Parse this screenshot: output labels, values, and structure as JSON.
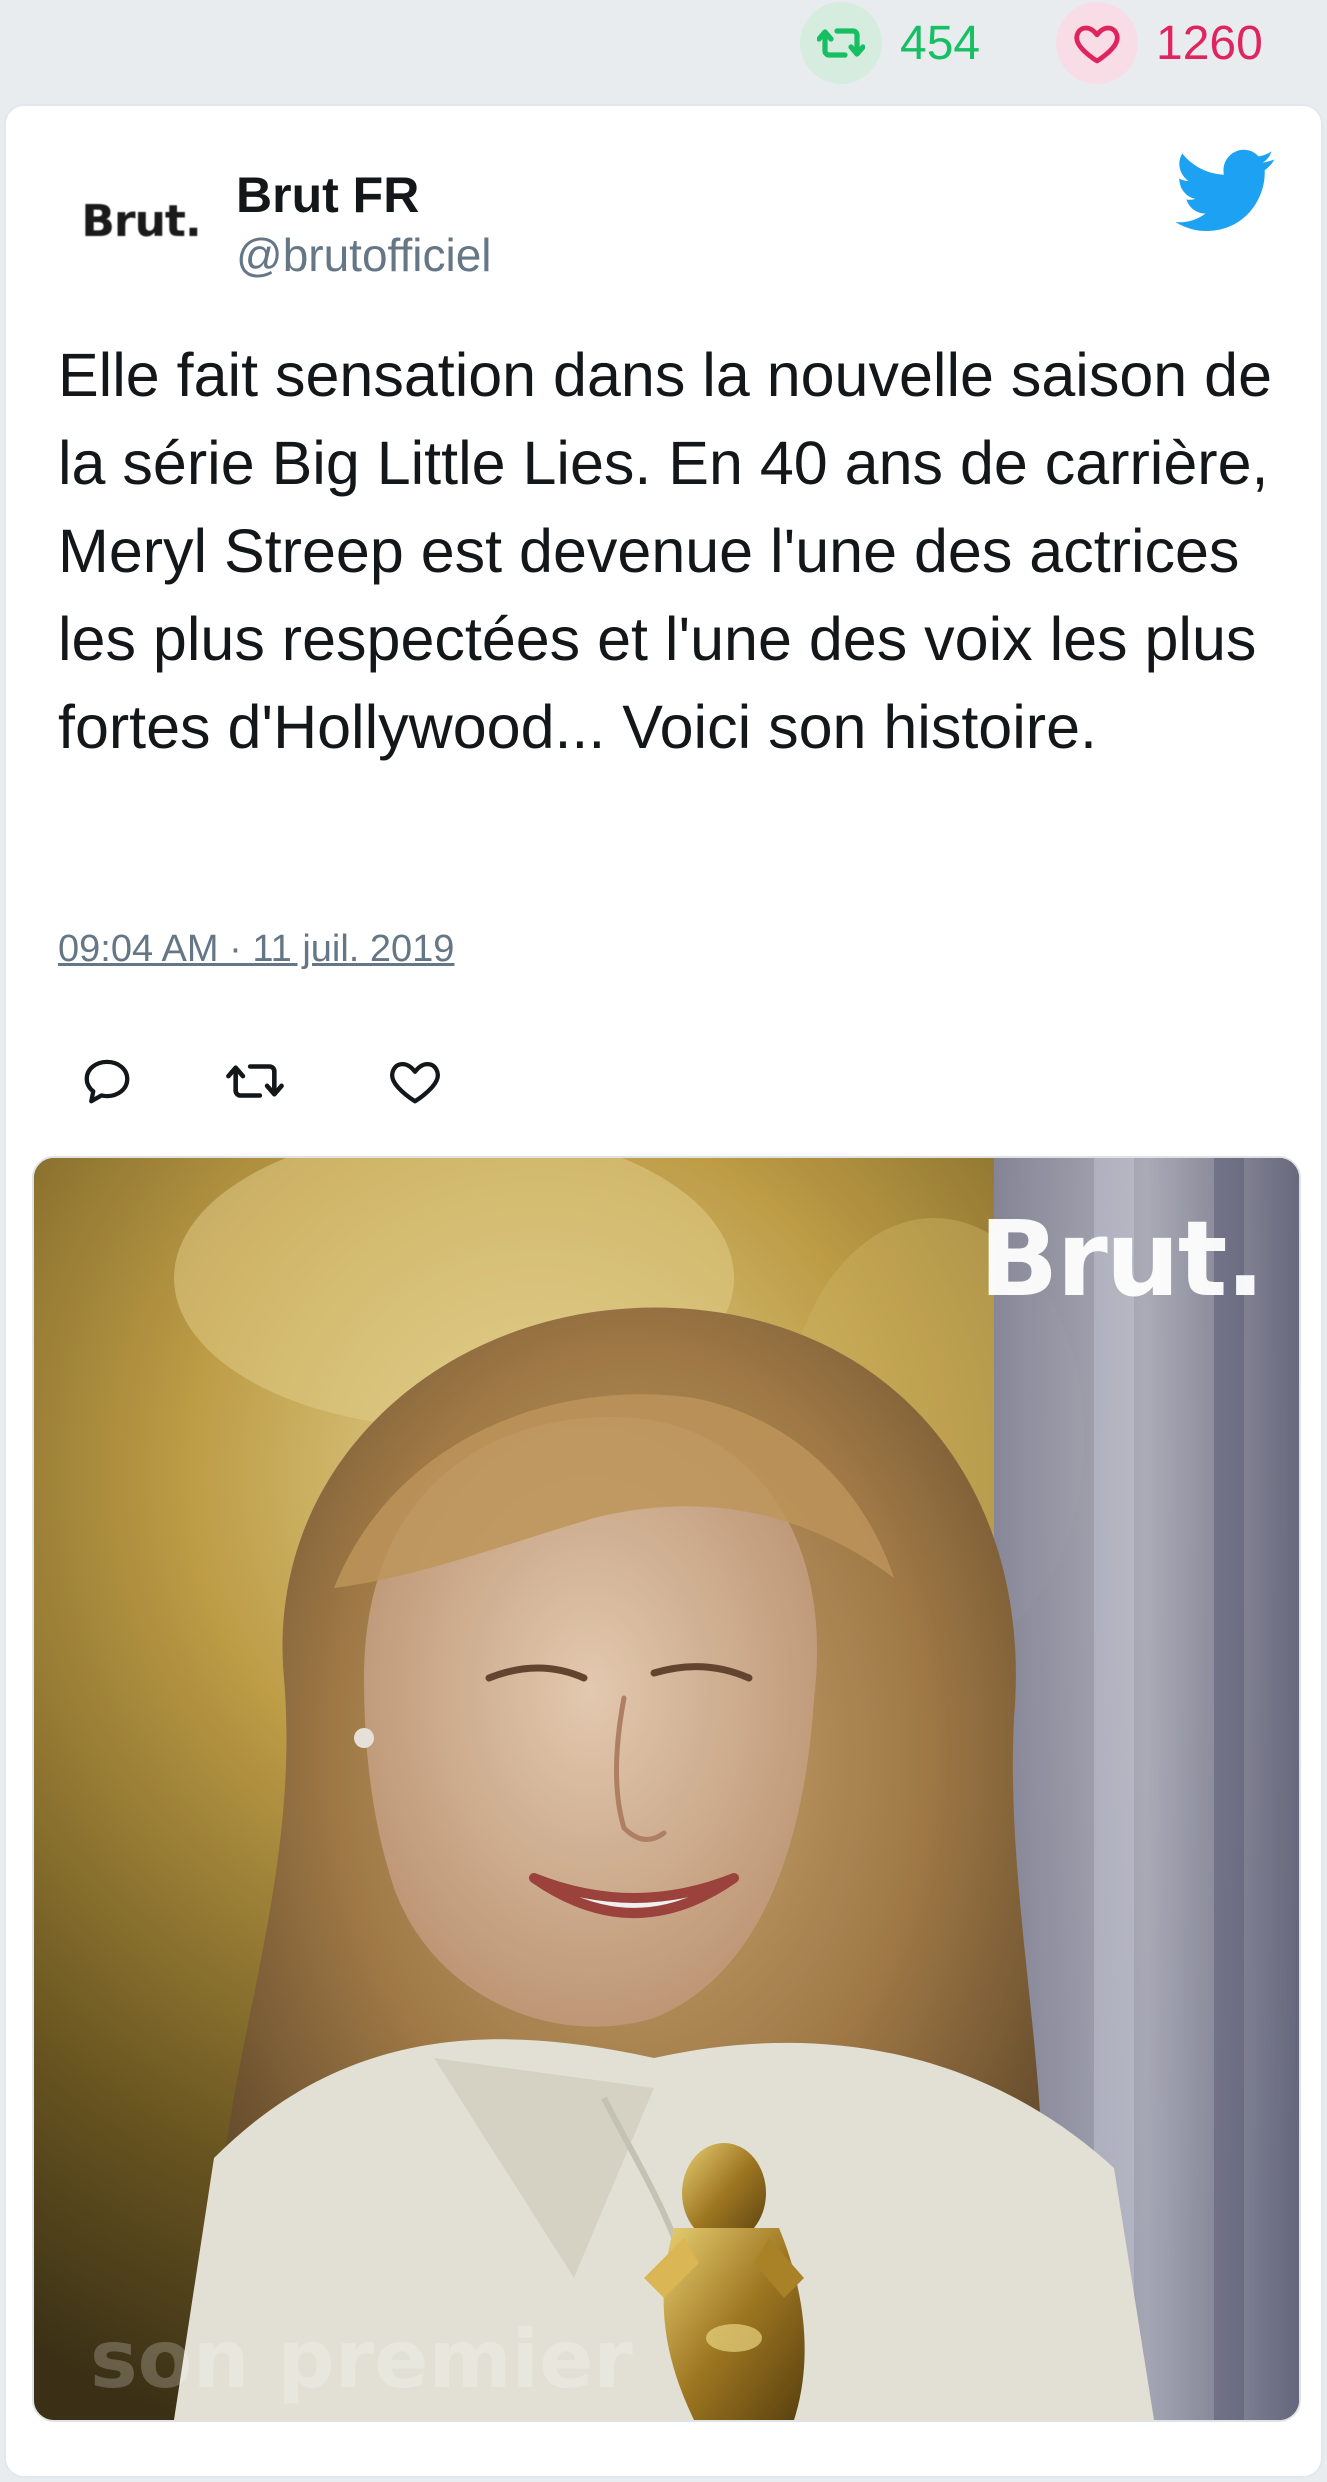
{
  "stats": {
    "retweet_count": "454",
    "like_count": "1260",
    "retweet_color": "#17bf63",
    "like_color": "#e0245e"
  },
  "tweet": {
    "avatar_text": "Brut.",
    "author_name": "Brut FR",
    "author_handle": "@brutofficiel",
    "text": "Elle fait sensation dans la nouvelle saison de la série Big Little Lies. En 40 ans de carrière, Meryl Streep est devenue l'une des actrices les plus respectées et l'une des voix les plus fortes d'Hollywood... Voici son histoire.",
    "timestamp": "09:04 AM · 11 juil. 2019",
    "brand_icon": "twitter-bird-icon",
    "brand_color": "#1da1f2"
  },
  "actions": [
    {
      "name": "reply",
      "icon": "reply-icon"
    },
    {
      "name": "retweet",
      "icon": "retweet-icon"
    },
    {
      "name": "like",
      "icon": "heart-icon"
    }
  ],
  "media": {
    "watermark": "Brut.",
    "caption": "son premier"
  }
}
